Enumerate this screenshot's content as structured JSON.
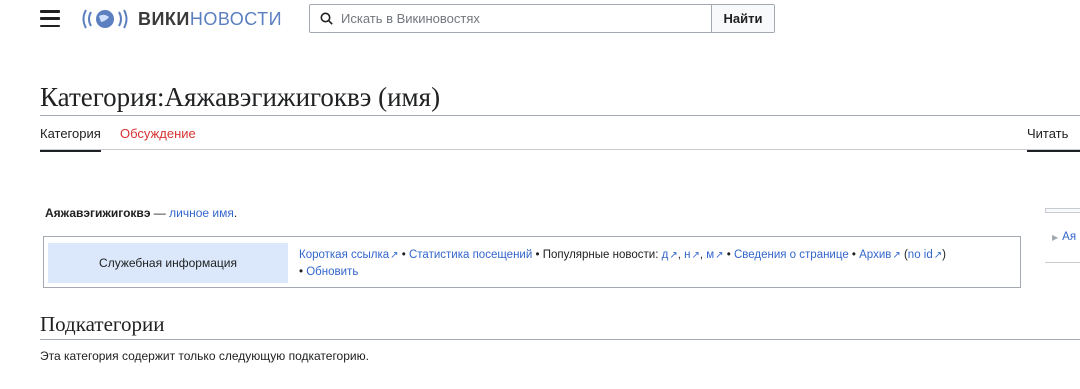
{
  "header": {
    "logo_bold": "ВИКИ",
    "logo_light": "НОВОСТИ",
    "search_placeholder": "Искать в Викиновостях",
    "search_button": "Найти"
  },
  "page": {
    "title": "Категория:Аяжавэгижигоквэ (имя)",
    "tabs": [
      {
        "label": "Категория",
        "active": true
      },
      {
        "label": "Обсуждение",
        "active": false
      }
    ],
    "read_tab": "Читать"
  },
  "content": {
    "intro_bold": "Аяжавэгижигоквэ",
    "intro_dash": " — ",
    "intro_link": "личное имя",
    "intro_end": ".",
    "service_box": {
      "header": "Служебная информация",
      "short_link": "Короткая ссылка",
      "stats": "Статистика посещений",
      "popular": "Популярные новости:",
      "pop_d": "д",
      "pop_n": "н",
      "pop_m": "м",
      "page_info": "Сведения о странице",
      "archive": "Архив",
      "no_id": "no id",
      "refresh": "Обновить"
    },
    "subcategories_heading": "Подкатегории",
    "subcategories_text": "Эта категория содержит только следующую подкатегорию."
  },
  "sidebar": {
    "item_label": "Ая"
  },
  "colors": {
    "link": "#3366cc",
    "talk_tab": "#d73333",
    "service_header_bg": "#dbe8fb"
  }
}
